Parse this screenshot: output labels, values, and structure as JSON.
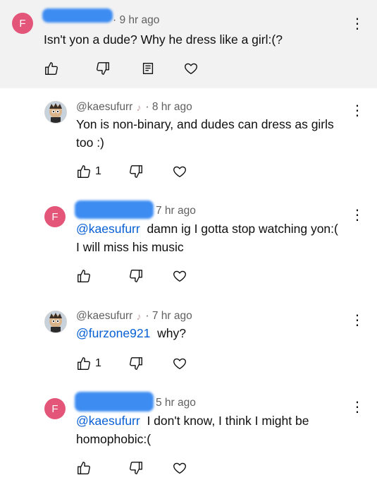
{
  "comments": [
    {
      "avatar_letter": "F",
      "timestamp": "· 9 hr ago",
      "text": "Isn't yon a dude? Why he dress like a girl:(?",
      "like_count": ""
    },
    {
      "username": "@kaesufurr",
      "creator_tag": "♪",
      "timestamp": "· 8 hr ago",
      "text": "Yon is non-binary, and dudes can dress as girls too :)",
      "like_count": "1"
    },
    {
      "avatar_letter": "F",
      "timestamp": "7 hr ago",
      "mention": "@kaesufurr",
      "text": "damn ig I gotta stop watching yon:( I will miss his music",
      "like_count": ""
    },
    {
      "username": "@kaesufurr",
      "creator_tag": "♪",
      "timestamp": "· 7 hr ago",
      "mention": "@furzone921",
      "text": "why?",
      "like_count": "1"
    },
    {
      "avatar_letter": "F",
      "timestamp": "5 hr ago",
      "mention": "@kaesufurr",
      "text": "I don't know, I think I might be homophobic:(",
      "like_count": ""
    }
  ],
  "icons": {
    "like": "thumbs-up-icon",
    "dislike": "thumbs-down-icon",
    "reply": "reply-icon",
    "heart": "heart-icon",
    "menu": "more-vert-icon"
  },
  "colors": {
    "avatar_bg": "#e4557a",
    "mention": "#065fd4",
    "redaction": "#3d8cf2"
  }
}
